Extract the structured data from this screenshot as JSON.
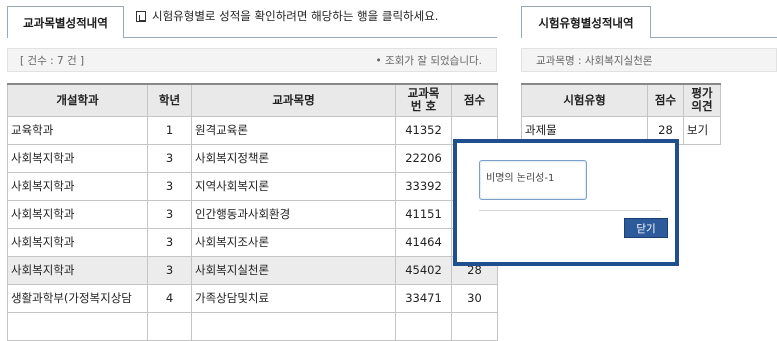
{
  "left_panel": {
    "tab_label": "교과목별성적내역",
    "hint_text": "시험유형별로 성적을 확인하려면 해당하는 행을 클릭하세요.",
    "count_text": "[ 건수 : 7 건 ]",
    "status_text": "• 조회가 잘 되었습니다.",
    "headers": {
      "dept": "개설학과",
      "year": "학년",
      "course": "교과목명",
      "code": "교과목\n번 호",
      "score": "점수"
    },
    "rows": [
      {
        "dept": "교육학과",
        "year": "1",
        "course": "원격교육론",
        "code": "41352",
        "score": ""
      },
      {
        "dept": "사회복지학과",
        "year": "3",
        "course": "사회복지정책론",
        "code": "22206",
        "score": ""
      },
      {
        "dept": "사회복지학과",
        "year": "3",
        "course": "지역사회복지론",
        "code": "33392",
        "score": ""
      },
      {
        "dept": "사회복지학과",
        "year": "3",
        "course": "인간행동과사회환경",
        "code": "41151",
        "score": ""
      },
      {
        "dept": "사회복지학과",
        "year": "3",
        "course": "사회복지조사론",
        "code": "41464",
        "score": ""
      },
      {
        "dept": "사회복지학과",
        "year": "3",
        "course": "사회복지실천론",
        "code": "45402",
        "score": "28"
      },
      {
        "dept": "생활과학부(가정복지상담",
        "year": "4",
        "course": "가족상담및치료",
        "code": "33471",
        "score": "30"
      }
    ]
  },
  "right_panel": {
    "tab_label": "시험유형별성적내역",
    "course_label": "교과목명 : 사회복지실천론",
    "headers": {
      "type": "시험유형",
      "score": "점수",
      "eval": "평가\n의견"
    },
    "rows": [
      {
        "type": "과제물",
        "score": "28",
        "eval": "보기"
      }
    ]
  },
  "modal": {
    "field_text": "비명의 논리성-1",
    "close_label": "닫기"
  }
}
